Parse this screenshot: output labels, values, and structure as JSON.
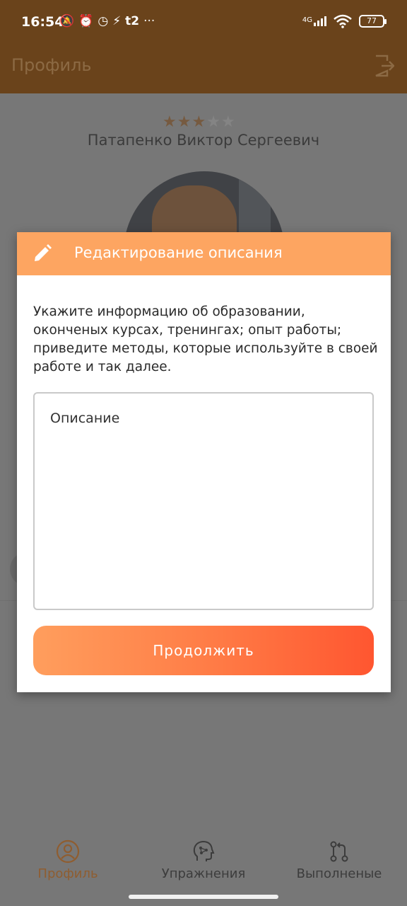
{
  "status_bar": {
    "time": "16:54",
    "network": "4G",
    "battery": "77"
  },
  "header": {
    "title": "Профиль"
  },
  "profile": {
    "rating": 3,
    "rating_max": 5,
    "full_name": "Патапенко Виктор Сергеевич"
  },
  "modal": {
    "title": "Редактирование описания",
    "hint": "Укажите информацию об образовании, оконченых курсах, тренингах; опыт работы; приведите методы, которые используйте в своей работе и так далее.",
    "description_placeholder": "Описание",
    "continue_button": "Продолжить"
  },
  "bottom_nav": {
    "items": [
      {
        "label": "Профиль",
        "icon": "profile-icon",
        "active": true
      },
      {
        "label": "Упражнения",
        "icon": "brain-icon",
        "active": false
      },
      {
        "label": "Выполненые",
        "icon": "merge-icon",
        "active": false
      }
    ]
  },
  "colors": {
    "status_bar": "#6a431b",
    "modal_header": "#fda561",
    "button_start": "#ff9e5d",
    "button_end": "#ff5630",
    "active_nav": "#8f5d30"
  }
}
